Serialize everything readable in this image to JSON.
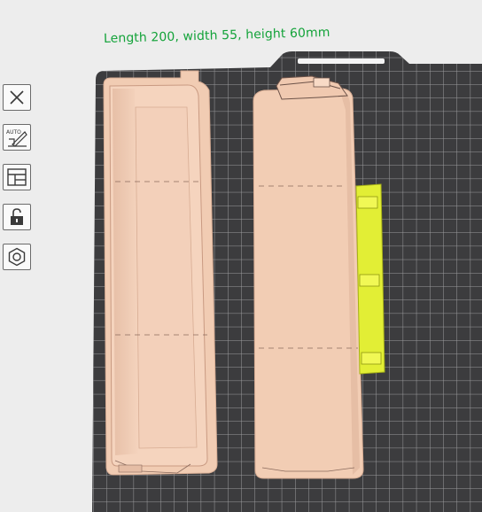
{
  "viewport": {
    "dimension_label": "Length 200, width 55, height 60mm",
    "colors": {
      "background": "#ededed",
      "plate": "#3d3d3f",
      "grid_line": "#9a9a9c",
      "model": "#f2cdb4",
      "selected_model": "#e4f03a",
      "dimension_label": "#14a33a"
    }
  },
  "left_toolbar": {
    "tools": [
      {
        "icon": "close-square-icon"
      },
      {
        "icon": "auto-orient-icon"
      },
      {
        "icon": "arrange-icon"
      },
      {
        "icon": "lock-icon"
      },
      {
        "icon": "settings-nut-icon"
      }
    ]
  }
}
